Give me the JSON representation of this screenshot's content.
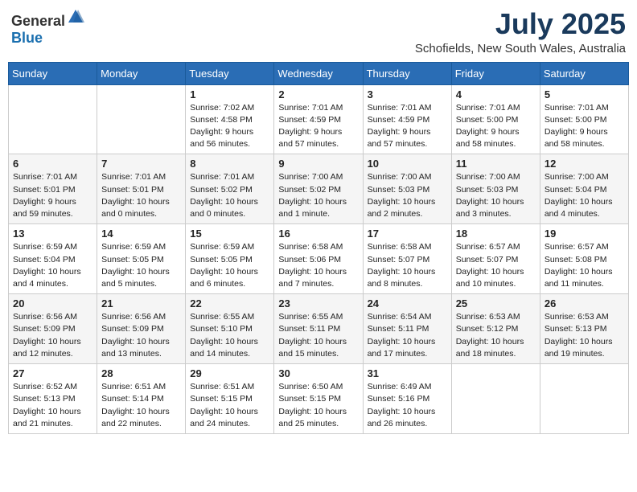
{
  "header": {
    "logo_general": "General",
    "logo_blue": "Blue",
    "month": "July 2025",
    "location": "Schofields, New South Wales, Australia"
  },
  "weekdays": [
    "Sunday",
    "Monday",
    "Tuesday",
    "Wednesday",
    "Thursday",
    "Friday",
    "Saturday"
  ],
  "weeks": [
    [
      null,
      null,
      {
        "day": 1,
        "sunrise": "Sunrise: 7:02 AM",
        "sunset": "Sunset: 4:58 PM",
        "daylight": "Daylight: 9 hours and 56 minutes."
      },
      {
        "day": 2,
        "sunrise": "Sunrise: 7:01 AM",
        "sunset": "Sunset: 4:59 PM",
        "daylight": "Daylight: 9 hours and 57 minutes."
      },
      {
        "day": 3,
        "sunrise": "Sunrise: 7:01 AM",
        "sunset": "Sunset: 4:59 PM",
        "daylight": "Daylight: 9 hours and 57 minutes."
      },
      {
        "day": 4,
        "sunrise": "Sunrise: 7:01 AM",
        "sunset": "Sunset: 5:00 PM",
        "daylight": "Daylight: 9 hours and 58 minutes."
      },
      {
        "day": 5,
        "sunrise": "Sunrise: 7:01 AM",
        "sunset": "Sunset: 5:00 PM",
        "daylight": "Daylight: 9 hours and 58 minutes."
      }
    ],
    [
      {
        "day": 6,
        "sunrise": "Sunrise: 7:01 AM",
        "sunset": "Sunset: 5:01 PM",
        "daylight": "Daylight: 9 hours and 59 minutes."
      },
      {
        "day": 7,
        "sunrise": "Sunrise: 7:01 AM",
        "sunset": "Sunset: 5:01 PM",
        "daylight": "Daylight: 10 hours and 0 minutes."
      },
      {
        "day": 8,
        "sunrise": "Sunrise: 7:01 AM",
        "sunset": "Sunset: 5:02 PM",
        "daylight": "Daylight: 10 hours and 0 minutes."
      },
      {
        "day": 9,
        "sunrise": "Sunrise: 7:00 AM",
        "sunset": "Sunset: 5:02 PM",
        "daylight": "Daylight: 10 hours and 1 minute."
      },
      {
        "day": 10,
        "sunrise": "Sunrise: 7:00 AM",
        "sunset": "Sunset: 5:03 PM",
        "daylight": "Daylight: 10 hours and 2 minutes."
      },
      {
        "day": 11,
        "sunrise": "Sunrise: 7:00 AM",
        "sunset": "Sunset: 5:03 PM",
        "daylight": "Daylight: 10 hours and 3 minutes."
      },
      {
        "day": 12,
        "sunrise": "Sunrise: 7:00 AM",
        "sunset": "Sunset: 5:04 PM",
        "daylight": "Daylight: 10 hours and 4 minutes."
      }
    ],
    [
      {
        "day": 13,
        "sunrise": "Sunrise: 6:59 AM",
        "sunset": "Sunset: 5:04 PM",
        "daylight": "Daylight: 10 hours and 4 minutes."
      },
      {
        "day": 14,
        "sunrise": "Sunrise: 6:59 AM",
        "sunset": "Sunset: 5:05 PM",
        "daylight": "Daylight: 10 hours and 5 minutes."
      },
      {
        "day": 15,
        "sunrise": "Sunrise: 6:59 AM",
        "sunset": "Sunset: 5:05 PM",
        "daylight": "Daylight: 10 hours and 6 minutes."
      },
      {
        "day": 16,
        "sunrise": "Sunrise: 6:58 AM",
        "sunset": "Sunset: 5:06 PM",
        "daylight": "Daylight: 10 hours and 7 minutes."
      },
      {
        "day": 17,
        "sunrise": "Sunrise: 6:58 AM",
        "sunset": "Sunset: 5:07 PM",
        "daylight": "Daylight: 10 hours and 8 minutes."
      },
      {
        "day": 18,
        "sunrise": "Sunrise: 6:57 AM",
        "sunset": "Sunset: 5:07 PM",
        "daylight": "Daylight: 10 hours and 10 minutes."
      },
      {
        "day": 19,
        "sunrise": "Sunrise: 6:57 AM",
        "sunset": "Sunset: 5:08 PM",
        "daylight": "Daylight: 10 hours and 11 minutes."
      }
    ],
    [
      {
        "day": 20,
        "sunrise": "Sunrise: 6:56 AM",
        "sunset": "Sunset: 5:09 PM",
        "daylight": "Daylight: 10 hours and 12 minutes."
      },
      {
        "day": 21,
        "sunrise": "Sunrise: 6:56 AM",
        "sunset": "Sunset: 5:09 PM",
        "daylight": "Daylight: 10 hours and 13 minutes."
      },
      {
        "day": 22,
        "sunrise": "Sunrise: 6:55 AM",
        "sunset": "Sunset: 5:10 PM",
        "daylight": "Daylight: 10 hours and 14 minutes."
      },
      {
        "day": 23,
        "sunrise": "Sunrise: 6:55 AM",
        "sunset": "Sunset: 5:11 PM",
        "daylight": "Daylight: 10 hours and 15 minutes."
      },
      {
        "day": 24,
        "sunrise": "Sunrise: 6:54 AM",
        "sunset": "Sunset: 5:11 PM",
        "daylight": "Daylight: 10 hours and 17 minutes."
      },
      {
        "day": 25,
        "sunrise": "Sunrise: 6:53 AM",
        "sunset": "Sunset: 5:12 PM",
        "daylight": "Daylight: 10 hours and 18 minutes."
      },
      {
        "day": 26,
        "sunrise": "Sunrise: 6:53 AM",
        "sunset": "Sunset: 5:13 PM",
        "daylight": "Daylight: 10 hours and 19 minutes."
      }
    ],
    [
      {
        "day": 27,
        "sunrise": "Sunrise: 6:52 AM",
        "sunset": "Sunset: 5:13 PM",
        "daylight": "Daylight: 10 hours and 21 minutes."
      },
      {
        "day": 28,
        "sunrise": "Sunrise: 6:51 AM",
        "sunset": "Sunset: 5:14 PM",
        "daylight": "Daylight: 10 hours and 22 minutes."
      },
      {
        "day": 29,
        "sunrise": "Sunrise: 6:51 AM",
        "sunset": "Sunset: 5:15 PM",
        "daylight": "Daylight: 10 hours and 24 minutes."
      },
      {
        "day": 30,
        "sunrise": "Sunrise: 6:50 AM",
        "sunset": "Sunset: 5:15 PM",
        "daylight": "Daylight: 10 hours and 25 minutes."
      },
      {
        "day": 31,
        "sunrise": "Sunrise: 6:49 AM",
        "sunset": "Sunset: 5:16 PM",
        "daylight": "Daylight: 10 hours and 26 minutes."
      },
      null,
      null
    ]
  ]
}
